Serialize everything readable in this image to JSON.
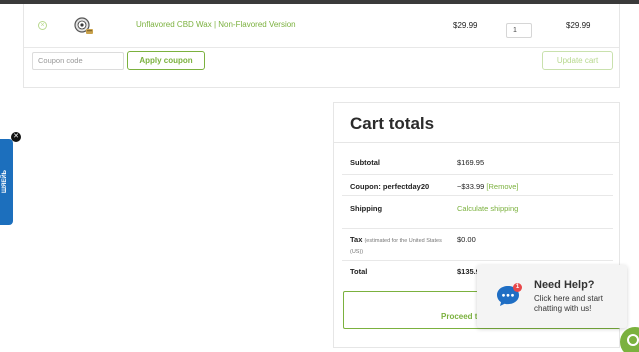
{
  "cart": {
    "item": {
      "remove_symbol": "×",
      "name": "Unflavored CBD Wax | Non-Flavored Version",
      "price": "$29.99",
      "quantity": "1",
      "subtotal": "$29.99"
    },
    "coupon_placeholder": "Coupon code",
    "apply_coupon_label": "Apply coupon",
    "update_cart_label": "Update cart"
  },
  "side_tab": {
    "text": "ШЯЕЙЬ",
    "close_symbol": "✕"
  },
  "totals": {
    "title": "Cart totals",
    "subtotal_label": "Subtotal",
    "subtotal_value": "$169.95",
    "coupon_label": "Coupon: perfectday20",
    "coupon_value": "−$33.99",
    "coupon_remove": "[Remove]",
    "shipping_label": "Shipping",
    "shipping_link": "Calculate shipping",
    "tax_label": "Tax",
    "tax_note": "(estimated for the United States (US))",
    "tax_value": "$0.00",
    "total_label": "Total",
    "total_value": "$135.9",
    "proceed_label": "Proceed to"
  },
  "chat": {
    "badge_count": "1",
    "title": "Need Help?",
    "subtitle": "Click here and start chatting with us!"
  },
  "colors": {
    "accent_green": "#7bb13e",
    "tab_blue": "#1c6fbd",
    "badge_red": "#e8484a"
  }
}
